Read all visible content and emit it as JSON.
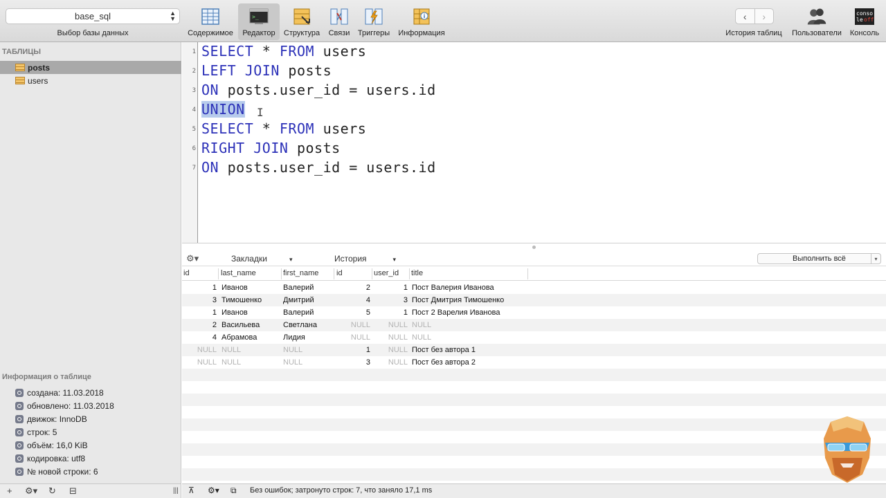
{
  "database": {
    "selected": "base_sql",
    "caption": "Выбор базы данных"
  },
  "toolbar": {
    "content": "Содержимое",
    "editor": "Редактор",
    "structure": "Структура",
    "relations": "Связи",
    "triggers": "Триггеры",
    "info": "Информация",
    "table_history": "История таблиц",
    "users": "Пользователи",
    "console": "Консоль",
    "console_icon_text": "conso le off"
  },
  "sidebar": {
    "heading": "ТАБЛИЦЫ",
    "tables": [
      "posts",
      "users"
    ],
    "selected_table": "posts",
    "info_heading": "Информация о таблице",
    "info": [
      "создана: 11.03.2018",
      "обновлено: 11.03.2018",
      "движок: InnoDB",
      "строк: 5",
      "объём: 16,0 KiB",
      "кодировка: utf8",
      "№ новой строки: 6"
    ]
  },
  "editor": {
    "line_numbers": [
      "1",
      "2",
      "3",
      "4",
      "5",
      "6",
      "7"
    ],
    "lines": [
      {
        "kw": "SELECT",
        "rest": " * ",
        "kw2": "FROM",
        "rest2": " users"
      },
      {
        "kw": "LEFT JOIN",
        "rest": " posts",
        "kw2": "",
        "rest2": ""
      },
      {
        "kw": "ON",
        "rest": " posts.user_id = users.id",
        "kw2": "",
        "rest2": ""
      },
      {
        "kw": "UNION",
        "rest": "",
        "kw2": "",
        "rest2": ""
      },
      {
        "kw": "SELECT",
        "rest": " * ",
        "kw2": "FROM",
        "rest2": " users"
      },
      {
        "kw": "RIGHT JOIN",
        "rest": " posts",
        "kw2": "",
        "rest2": ""
      },
      {
        "kw": "ON",
        "rest": " posts.user_id = users.id",
        "kw2": "",
        "rest2": ""
      }
    ],
    "selected_word": "UNION"
  },
  "results_bar": {
    "bookmarks": "Закладки",
    "history": "История",
    "run_all": "Выполнить всё"
  },
  "results": {
    "columns": [
      "id",
      "last_name",
      "first_name",
      "id",
      "user_id",
      "title"
    ],
    "rows": [
      [
        "1",
        "Иванов",
        "Валерий",
        "2",
        "1",
        "Пост Валерия Иванова"
      ],
      [
        "3",
        "Тимошенко",
        "Дмитрий",
        "4",
        "3",
        "Пост Дмитрия Тимошенко"
      ],
      [
        "1",
        "Иванов",
        "Валерий",
        "5",
        "1",
        "Пост 2 Варелия Иванова"
      ],
      [
        "2",
        "Васильева",
        "Светлана",
        "NULL",
        "NULL",
        "NULL"
      ],
      [
        "4",
        "Абрамова",
        "Лидия",
        "NULL",
        "NULL",
        "NULL"
      ],
      [
        "NULL",
        "NULL",
        "NULL",
        "1",
        "NULL",
        "Пост без автора 1"
      ],
      [
        "NULL",
        "NULL",
        "NULL",
        "3",
        "NULL",
        "Пост без автора 2"
      ]
    ]
  },
  "status": {
    "message": "Без ошибок; затронуто строк: 7, что заняло 17,1 ms"
  },
  "colors": {
    "keyword": "#2c31b8",
    "selection": "#b7cbec",
    "null_text": "#b3b3b3",
    "sidebar_selected": "#a9a9a9"
  },
  "icons": [
    "table-icon",
    "gear-icon",
    "plus-icon",
    "refresh-icon",
    "filter-icon",
    "chevron-left-icon",
    "chevron-right-icon",
    "users-icon",
    "console-icon",
    "avatar-icon"
  ]
}
